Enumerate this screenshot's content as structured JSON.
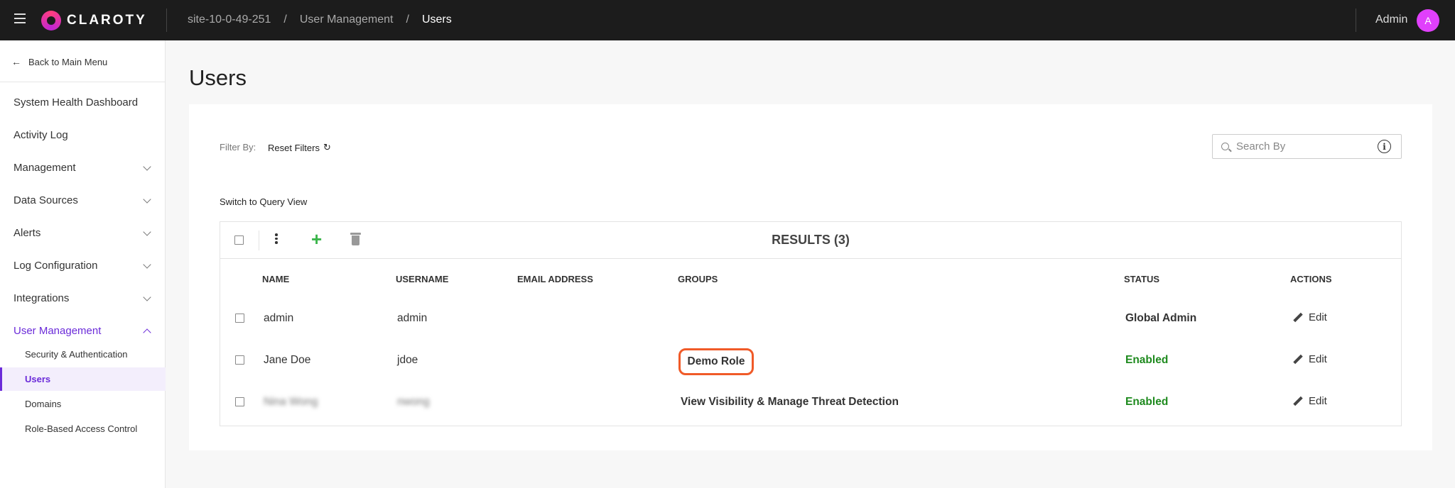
{
  "topbar": {
    "logo": "CLAROTY",
    "breadcrumb": [
      "site-10-0-49-251",
      "User Management",
      "Users"
    ],
    "user_name": "Admin",
    "avatar_initial": "A"
  },
  "sidebar": {
    "back_label": "Back to Main Menu",
    "items": [
      {
        "label": "System Health Dashboard",
        "expandable": false
      },
      {
        "label": "Activity Log",
        "expandable": false
      },
      {
        "label": "Management",
        "expandable": true
      },
      {
        "label": "Data Sources",
        "expandable": true
      },
      {
        "label": "Alerts",
        "expandable": true
      },
      {
        "label": "Log Configuration",
        "expandable": true
      },
      {
        "label": "Integrations",
        "expandable": true
      },
      {
        "label": "User Management",
        "expandable": true,
        "expanded": true,
        "active": true
      }
    ],
    "sub_items": [
      {
        "label": "Security & Authentication"
      },
      {
        "label": "Users",
        "active": true
      },
      {
        "label": "Domains"
      },
      {
        "label": "Role-Based Access Control"
      }
    ]
  },
  "main": {
    "title": "Users",
    "filter_label": "Filter By:",
    "reset_filters": "Reset Filters",
    "search_placeholder": "Search By",
    "query_view": "Switch to Query View",
    "results_label": "RESULTS (3)",
    "columns": [
      "NAME",
      "USERNAME",
      "EMAIL ADDRESS",
      "GROUPS",
      "STATUS",
      "ACTIONS"
    ],
    "rows": [
      {
        "name": "admin",
        "username": "admin",
        "email": "",
        "groups": "",
        "status": "Global Admin",
        "action": "Edit"
      },
      {
        "name": "Jane Doe",
        "username": "jdoe",
        "email": "",
        "groups": "Demo Role",
        "status": "Enabled",
        "action": "Edit"
      },
      {
        "name": "Nina Wong",
        "username": "nwong",
        "email": "",
        "groups": "View Visibility & Manage Threat Detection",
        "status": "Enabled",
        "action": "Edit"
      }
    ]
  },
  "colors": {
    "accent": "#6b2bd9",
    "enabled": "#1e8a1e",
    "highlight": "#f05a28",
    "add": "#3ab54a"
  }
}
